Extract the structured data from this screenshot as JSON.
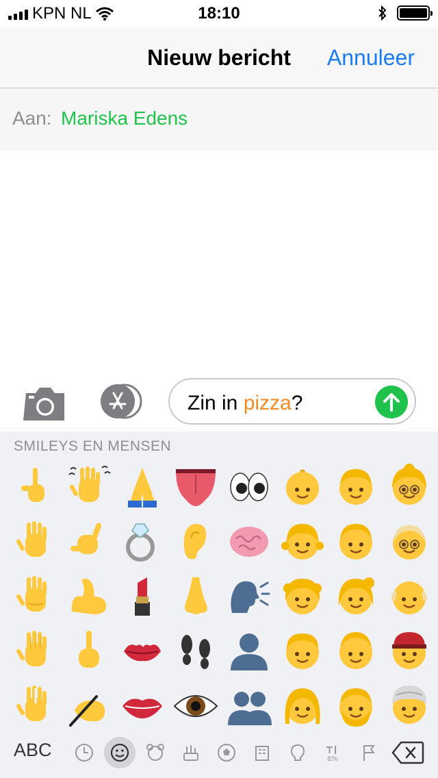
{
  "status": {
    "carrier": "KPN NL",
    "time": "18:10"
  },
  "nav": {
    "title": "Nieuw bericht",
    "cancel": "Annuleer"
  },
  "to": {
    "label": "Aan:",
    "recipient": "Mariska Edens"
  },
  "input": {
    "text_before": "Zin in ",
    "text_highlight": "pizza",
    "text_after": "?"
  },
  "keyboard": {
    "category_label": "SMILEYS EN MENSEN",
    "abc_label": "ABC",
    "emojis": [
      "point-up",
      "waving-hand",
      "folded-hands",
      "tongue",
      "eyes",
      "baby",
      "child",
      "older-woman",
      "raised-hand",
      "call-me-hand",
      "ring",
      "ear",
      "brain",
      "girl",
      "man",
      "older-man-glasses",
      "raised-back-hand",
      "flexed-biceps",
      "lipstick",
      "nose",
      "speaking-head",
      "woman-blond-curly",
      "woman-blond",
      "older-man",
      "hand-splayed",
      "middle-finger",
      "kiss-mark",
      "footprints",
      "bust-silhouette",
      "boy",
      "man-blond",
      "man-cap",
      "vulcan-salute",
      "writing-hand",
      "mouth",
      "eye",
      "busts-silhouette",
      "woman",
      "bearded-man",
      "turban-person"
    ],
    "categories": [
      "recent",
      "smileys",
      "animals",
      "food",
      "activity",
      "travel",
      "objects",
      "symbols",
      "flags"
    ],
    "active_category": "smileys"
  },
  "colors": {
    "accent": "#1a7cf5",
    "recipient": "#1fc24a",
    "send": "#1fc24a",
    "highlight": "#f08a24",
    "skin": "#ffc83d"
  }
}
